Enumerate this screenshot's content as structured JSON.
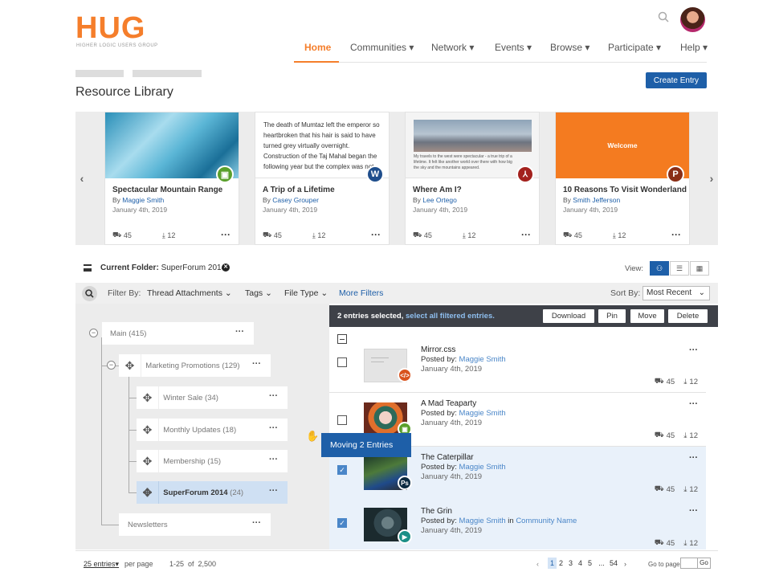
{
  "brand": {
    "logo": "HUG",
    "tagline": "HIGHER LOGIC USERS GROUP",
    "accent": "#f57e2b",
    "primary": "#1e5fa8"
  },
  "nav": [
    {
      "label": "Home"
    },
    {
      "label": "Communities"
    },
    {
      "label": "Network"
    },
    {
      "label": "Events"
    },
    {
      "label": "Browse"
    },
    {
      "label": "Participate"
    },
    {
      "label": "Help"
    }
  ],
  "page": {
    "title": "Resource Library",
    "create_label": "Create Entry"
  },
  "cards": [
    {
      "title": "Spectacular Mountain Range",
      "by": "By",
      "author": "Maggie Smith",
      "date": "January 4th, 2019",
      "views": "45",
      "downloads": "12",
      "icon": "image-icon",
      "excerpt": ""
    },
    {
      "title": "A Trip of a Lifetime",
      "by": "By",
      "author": "Casey Grouper",
      "date": "January 4th, 2019",
      "views": "45",
      "downloads": "12",
      "icon": "word-icon",
      "excerpt": "The death of Mumtaz left the emperor so heartbroken that his hair is said to have turned grey virtually overnight. Construction of the Taj Mahal began the following year but the complex was not"
    },
    {
      "title": "Where Am I?",
      "by": "By",
      "author": "Lee Ortego",
      "date": "January 4th, 2019",
      "views": "45",
      "downloads": "12",
      "icon": "pdf-icon",
      "excerpt": "My travels to the west were spectacular - a true trip of a lifetime. It felt like another world over there with how big the sky and the mountains appeared."
    },
    {
      "title": "10 Reasons To Visit Wonderland",
      "by": "By",
      "author": "Smith Jefferson",
      "date": "January 4th, 2019",
      "views": "45",
      "downloads": "12",
      "icon": "powerpoint-icon",
      "excerpt": "Welcome"
    }
  ],
  "folder": {
    "label": "Current Folder:",
    "name": "SuperForum 2014",
    "view_label": "View:"
  },
  "filters": {
    "filter_by": "Filter By:",
    "thread": "Thread Attachments",
    "tags": "Tags",
    "file_type": "File Type",
    "more": "More Filters",
    "sort_by": "Sort By:",
    "sort_value": "Most Recent"
  },
  "tree": {
    "main": {
      "label": "Main",
      "count": "(415)"
    },
    "marketing": {
      "label": "Marketing Promotions",
      "count": "(129)"
    },
    "winter": {
      "label": "Winter Sale",
      "count": "(34)"
    },
    "monthly": {
      "label": "Monthly Updates",
      "count": "(18)"
    },
    "membership": {
      "label": "Membership",
      "count": "(15)"
    },
    "superforum": {
      "label": "SuperForum 2014",
      "count": "(24)"
    },
    "newsletters": {
      "label": "Newsletters",
      "count": ""
    }
  },
  "drag": {
    "label": "Moving 2 Entries"
  },
  "selection": {
    "text": "2 entries selected,",
    "link": "select all filtered entries.",
    "actions": [
      "Download",
      "Pin",
      "Move",
      "Delete"
    ]
  },
  "entries": [
    {
      "title": "Mirror.css",
      "posted": "Posted by:",
      "author": "Maggie Smith",
      "in": "",
      "community": "",
      "date": "January 4th, 2019",
      "views": "45",
      "downloads": "12",
      "checked": false,
      "icon": "code-icon"
    },
    {
      "title": "A Mad Teaparty",
      "posted": "Posted by:",
      "author": "Maggie Smith",
      "in": "",
      "community": "",
      "date": "January 4th, 2019",
      "views": "45",
      "downloads": "12",
      "checked": false,
      "icon": "image-icon"
    },
    {
      "title": "The Caterpillar",
      "posted": "Posted by:",
      "author": "Maggie Smith",
      "in": "",
      "community": "",
      "date": "January 4th, 2019",
      "views": "45",
      "downloads": "12",
      "checked": true,
      "icon": "photoshop-icon"
    },
    {
      "title": "The Grin",
      "posted": "Posted by:",
      "author": "Maggie Smith",
      "in": "in",
      "community": "Community Name",
      "date": "January 4th, 2019",
      "views": "45",
      "downloads": "12",
      "checked": true,
      "icon": "video-icon"
    }
  ],
  "footer": {
    "per_page_value": "25 entries",
    "per_page_label": "per page",
    "range": "1-25  of  2,500",
    "pages": [
      "1",
      "2",
      "3",
      "4",
      "5",
      "...",
      "54"
    ],
    "goto_label": "Go to page",
    "go": "Go"
  }
}
